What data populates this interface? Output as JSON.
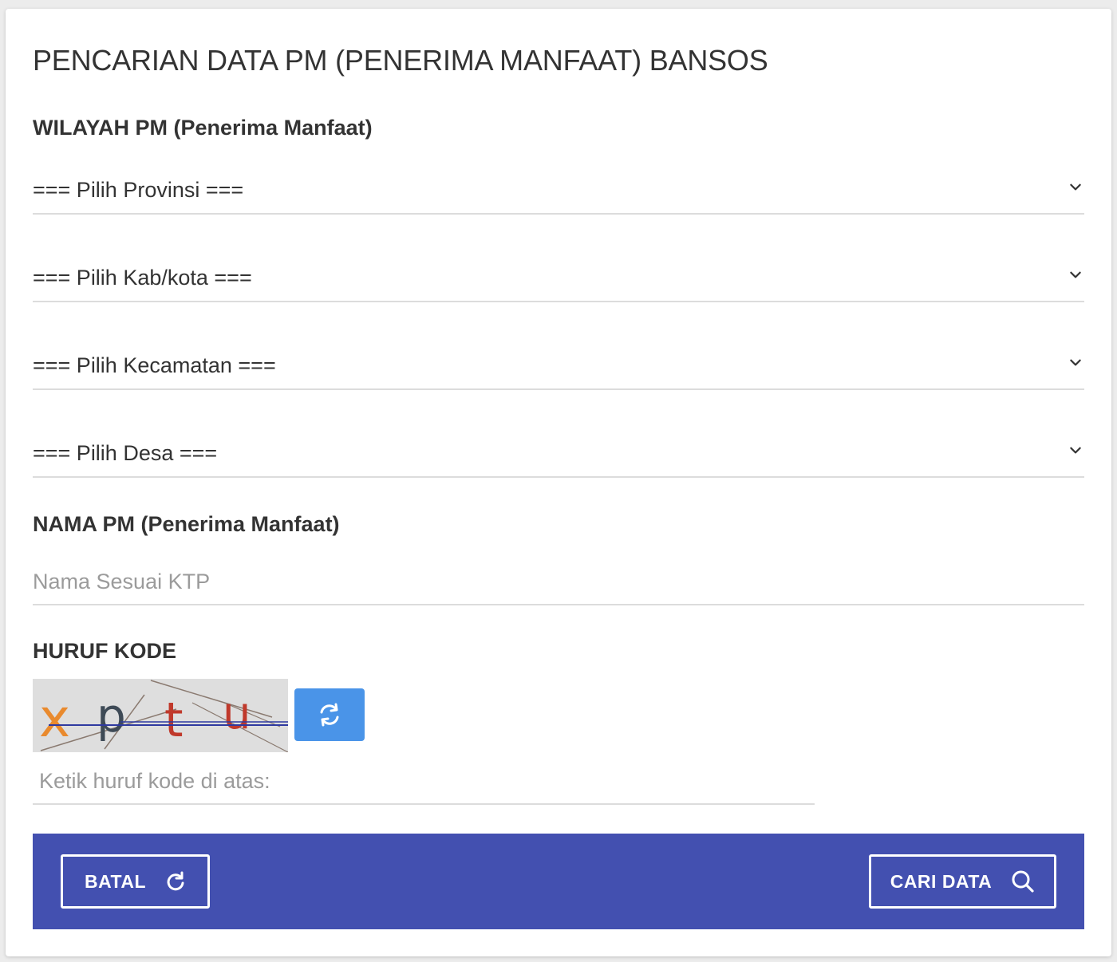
{
  "page": {
    "title": "PENCARIAN DATA PM (PENERIMA MANFAAT) BANSOS"
  },
  "wilayah": {
    "label": "WILAYAH PM (Penerima Manfaat)",
    "selects": [
      {
        "selected": "=== Pilih Provinsi ==="
      },
      {
        "selected": "=== Pilih Kab/kota ==="
      },
      {
        "selected": "=== Pilih Kecamatan ==="
      },
      {
        "selected": "=== Pilih Desa ==="
      }
    ]
  },
  "nama": {
    "label": "NAMA PM (Penerima Manfaat)",
    "value": "",
    "placeholder": "Nama Sesuai KTP"
  },
  "kode": {
    "label": "HURUF KODE",
    "captcha_text": "xptu",
    "input_value": "",
    "input_placeholder": "Ketik huruf kode di atas:",
    "refresh_icon": "refresh-icon"
  },
  "actions": {
    "cancel_label": "BATAL",
    "cancel_icon": "reload-icon",
    "search_label": "CARI DATA",
    "search_icon": "search-icon"
  },
  "colors": {
    "action_bar": "#4350b0",
    "refresh_button": "#4a94e8",
    "text": "#333333",
    "placeholder": "#9b9b9b"
  }
}
